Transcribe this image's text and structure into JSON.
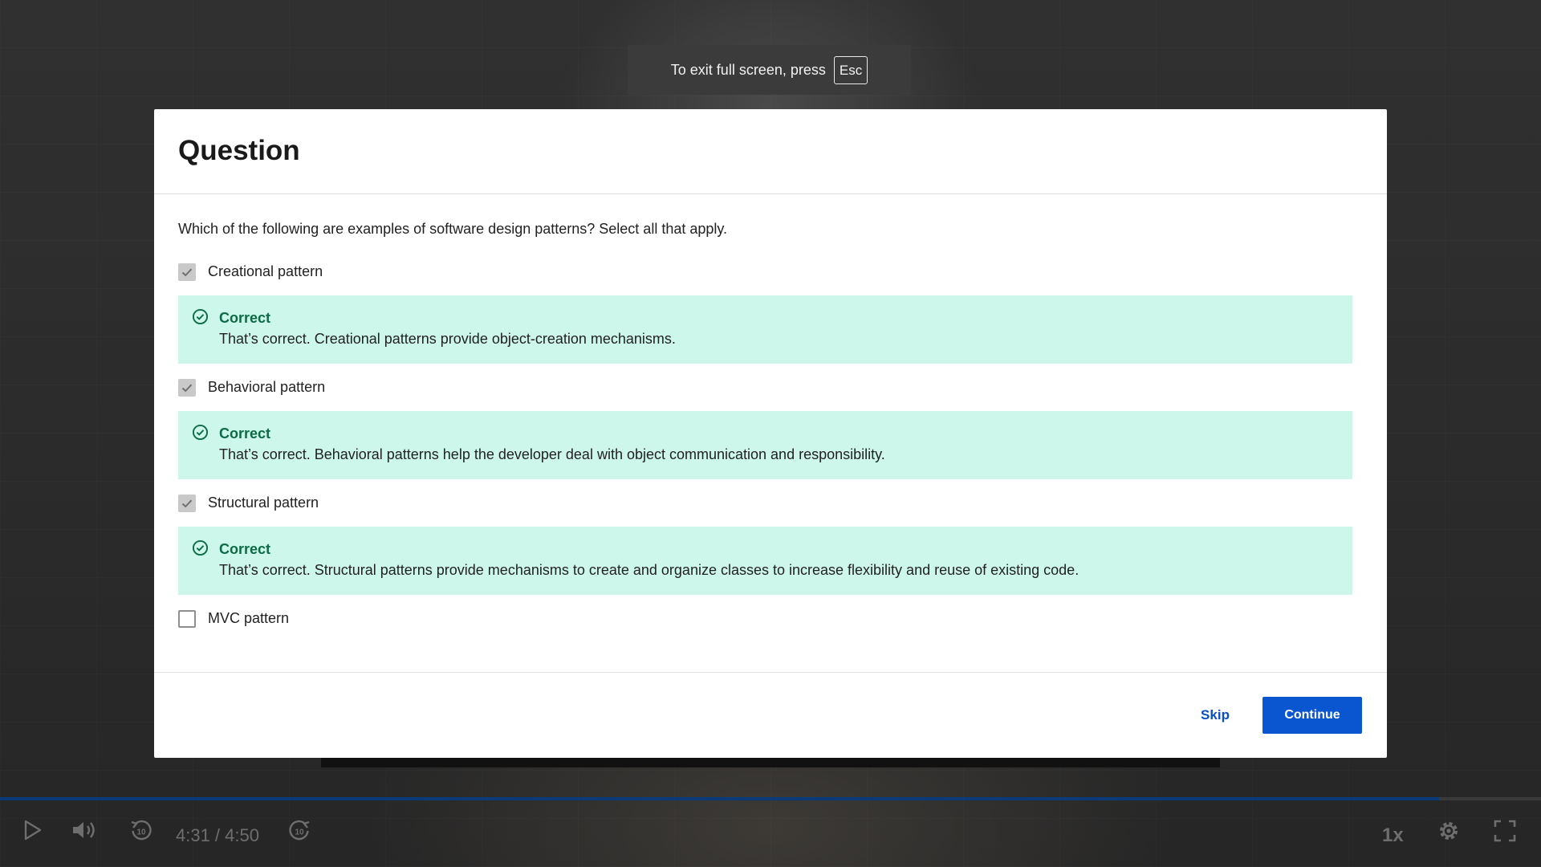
{
  "fullscreen_notice": {
    "text": "To exit full screen, press",
    "key": "Esc"
  },
  "modal": {
    "title": "Question",
    "question": "Which of the following are examples of software design patterns? Select all that apply.",
    "options": [
      {
        "label": "Creational pattern",
        "checked": true,
        "feedback_title": "Correct",
        "feedback_message": "That’s correct. Creational patterns provide object-creation mechanisms."
      },
      {
        "label": "Behavioral pattern",
        "checked": true,
        "feedback_title": "Correct",
        "feedback_message": "That’s correct. Behavioral patterns help the developer deal with object communication and responsibility."
      },
      {
        "label": "Structural pattern",
        "checked": true,
        "feedback_title": "Correct",
        "feedback_message": "That’s correct. Structural patterns provide mechanisms to create and organize classes to increase flexibility and reuse of existing code."
      },
      {
        "label": "MVC pattern",
        "checked": false
      }
    ],
    "skip_label": "Skip",
    "continue_label": "Continue"
  },
  "player": {
    "time": "4:31 / 4:50",
    "progress": 0.934,
    "speed": "1x",
    "icons": {
      "play": "play-icon",
      "volume": "volume-icon",
      "rewind": "rewind-10-icon",
      "forward": "forward-10-icon",
      "settings": "gear-icon",
      "fullscreen": "fullscreen-exit-icon"
    }
  },
  "colors": {
    "accent": "#0a56d0",
    "feedback_bg": "#cdf7ea",
    "feedback_title": "#0b6b47"
  }
}
